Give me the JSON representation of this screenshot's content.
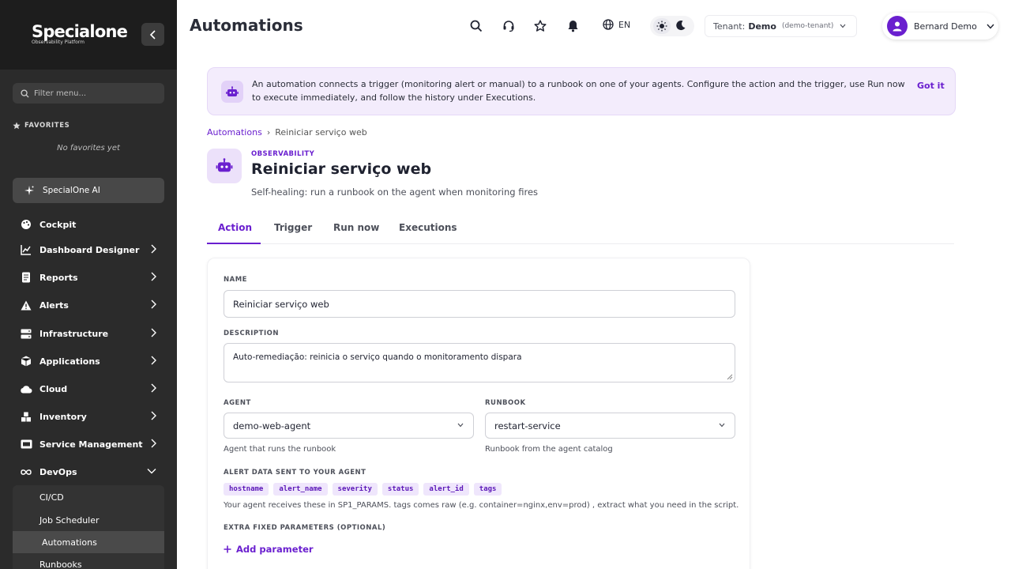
{
  "sidebar": {
    "logo": "Specialone",
    "logo_sub": "Observability Platform",
    "filter_placeholder": "Filter menu...",
    "favorites_title": "FAVORITES",
    "favorites_empty": "No favorites yet",
    "ai_label": "SpecialOne AI",
    "items": [
      {
        "label": "Cockpit",
        "icon": "palette-icon"
      },
      {
        "label": "Dashboard Designer",
        "icon": "chart-line-icon"
      },
      {
        "label": "Reports",
        "icon": "document-icon"
      },
      {
        "label": "Alerts",
        "icon": "warning-icon"
      },
      {
        "label": "Infrastructure",
        "icon": "server-icon"
      },
      {
        "label": "Applications",
        "icon": "cube-icon"
      },
      {
        "label": "Cloud",
        "icon": "cloud-icon"
      },
      {
        "label": "Inventory",
        "icon": "boxes-icon"
      },
      {
        "label": "Service Management",
        "icon": "ticket-icon"
      },
      {
        "label": "DevOps",
        "icon": "infinity-icon"
      }
    ],
    "devops_sub": [
      "CI/CD",
      "Job Scheduler",
      "Automations",
      "Runbooks"
    ]
  },
  "header": {
    "title": "Automations",
    "lang": "EN",
    "tenant_label": "Tenant:",
    "tenant_name": "Demo",
    "tenant_slug": "(demo-tenant)",
    "user_name": "Bernard Demo"
  },
  "banner": {
    "text": "An automation connects a trigger (monitoring alert or manual) to a runbook on one of your agents. Configure the action and the trigger, use Run now to execute immediately, and follow the history under Executions.",
    "button": "Got it"
  },
  "breadcrumb": {
    "parent": "Automations",
    "sep": "›",
    "current": "Reiniciar serviço web"
  },
  "detail": {
    "eyebrow": "OBSERVABILITY",
    "title": "Reiniciar serviço web",
    "subtitle": "Self-healing: run a runbook on the agent when monitoring fires"
  },
  "tabs": [
    "Action",
    "Trigger",
    "Run now",
    "Executions"
  ],
  "form": {
    "name_label": "NAME",
    "name_value": "Reiniciar serviço web",
    "desc_label": "DESCRIPTION",
    "desc_value": "Auto-remediação: reinicia o serviço quando o monitoramento dispara",
    "agent_label": "AGENT",
    "agent_value": "demo-web-agent",
    "agent_help": "Agent that runs the runbook",
    "runbook_label": "RUNBOOK",
    "runbook_value": "restart-service",
    "runbook_help": "Runbook from the agent catalog",
    "alert_data_label": "ALERT DATA SENT TO YOUR AGENT",
    "chips": [
      "hostname",
      "alert_name",
      "severity",
      "status",
      "alert_id",
      "tags"
    ],
    "alert_help": "Your agent receives these in SP1_PARAMS. tags comes raw (e.g. container=nginx,env=prod) , extract what you need in the script.",
    "extra_label": "EXTRA FIXED PARAMETERS (OPTIONAL)",
    "add_param": "Add parameter"
  },
  "colors": {
    "accent": "#6a1fcf",
    "sidebar_bg": "#2b2b2b",
    "banner_bg": "#f3ecfc"
  }
}
